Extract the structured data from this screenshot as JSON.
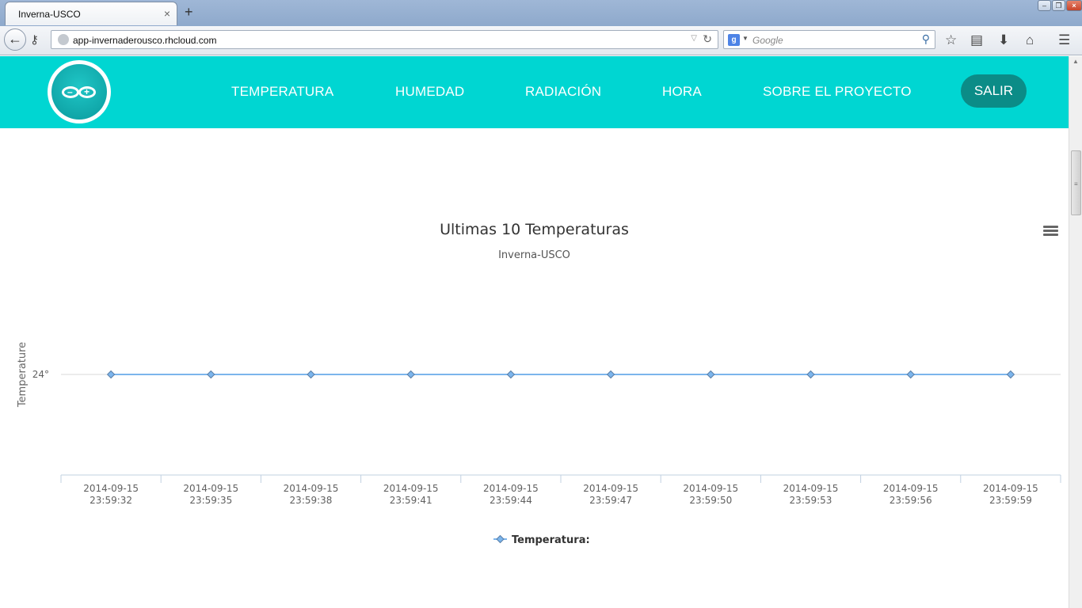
{
  "browser": {
    "tab_title": "Inverna-USCO",
    "tab_close": "×",
    "new_tab": "+",
    "url": "app-invernaderousco.rhcloud.com",
    "search_engine_badge": "g",
    "search_placeholder": "Google",
    "icons": [
      "back-arrow-icon",
      "key-icon",
      "globe-icon",
      "reload-icon",
      "search-icon",
      "bookmark-star-icon",
      "bookmarks-list-icon",
      "download-icon",
      "home-icon",
      "menu-icon"
    ]
  },
  "header": {
    "nav": [
      "TEMPERATURA",
      "HUMEDAD",
      "RADIACIÓN",
      "HORA",
      "SOBRE EL PROYECTO"
    ],
    "logout": "SALIR",
    "colors": {
      "header_bg": "#00d6d2",
      "logout_bg": "#0b8c87",
      "nav_text": "#ffffff"
    }
  },
  "chart_data": {
    "type": "line",
    "title": "Ultimas 10 Temperaturas",
    "subtitle": "Inverna-USCO",
    "ylabel": "Temperature",
    "y_tick_labels": [
      "24°"
    ],
    "x": [
      [
        "2014-09-15",
        "23:59:32"
      ],
      [
        "2014-09-15",
        "23:59:35"
      ],
      [
        "2014-09-15",
        "23:59:38"
      ],
      [
        "2014-09-15",
        "23:59:41"
      ],
      [
        "2014-09-15",
        "23:59:44"
      ],
      [
        "2014-09-15",
        "23:59:47"
      ],
      [
        "2014-09-15",
        "23:59:50"
      ],
      [
        "2014-09-15",
        "23:59:53"
      ],
      [
        "2014-09-15",
        "23:59:56"
      ],
      [
        "2014-09-15",
        "23:59:59"
      ]
    ],
    "series": [
      {
        "name": "Temperatura:",
        "values": [
          24,
          24,
          24,
          24,
          24,
          24,
          24,
          24,
          24,
          24
        ],
        "color": "#7cb5ec"
      }
    ],
    "legend_position": "bottom-center",
    "grid": true
  }
}
